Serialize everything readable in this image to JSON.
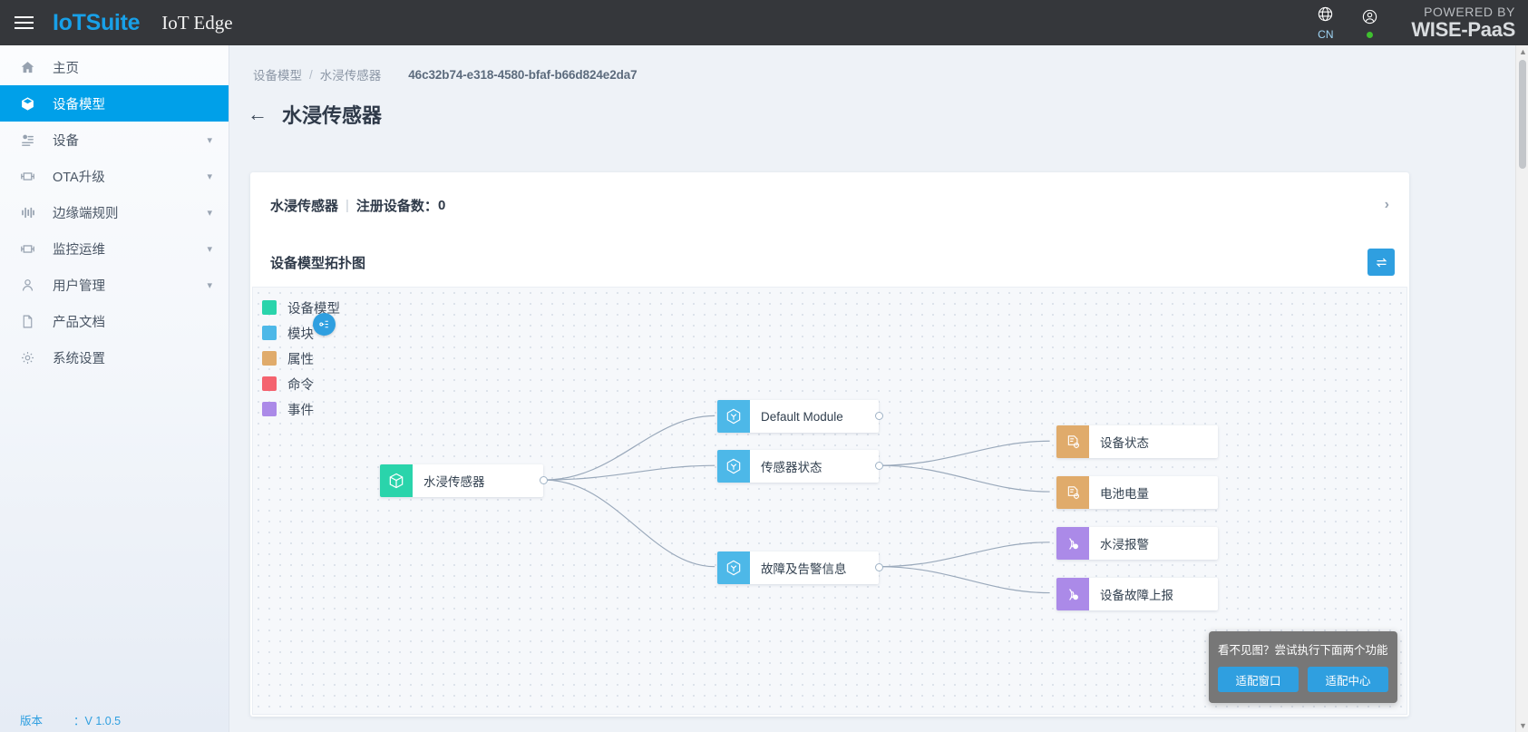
{
  "topbar": {
    "menu_icon": "hamburger-icon",
    "brand": "IoTSuite",
    "subtitle": "IoT Edge",
    "language_icon": "globe-icon",
    "language_label": "CN",
    "account_icon": "user-circle-icon",
    "status_dot_color": "#3fc02f",
    "powered_by_line1": "POWERED BY",
    "powered_by_line2": "WISE-PaaS"
  },
  "sidebar": {
    "items": [
      {
        "label": "主页",
        "icon": "home-icon",
        "expandable": false,
        "active": false
      },
      {
        "label": "设备模型",
        "icon": "cube-icon",
        "expandable": false,
        "active": true
      },
      {
        "label": "设备",
        "icon": "devices-icon",
        "expandable": true,
        "active": false
      },
      {
        "label": "OTA升级",
        "icon": "chip-icon",
        "expandable": true,
        "active": false
      },
      {
        "label": "边缘端规则",
        "icon": "rules-icon",
        "expandable": true,
        "active": false
      },
      {
        "label": "监控运维",
        "icon": "monitor-icon",
        "expandable": true,
        "active": false
      },
      {
        "label": "用户管理",
        "icon": "user-icon",
        "expandable": true,
        "active": false
      },
      {
        "label": "产品文档",
        "icon": "document-icon",
        "expandable": false,
        "active": false
      },
      {
        "label": "系统设置",
        "icon": "gear-icon",
        "expandable": false,
        "active": false
      }
    ],
    "version_label": "版本",
    "version_value": "：V 1.0.5"
  },
  "breadcrumb": {
    "items": [
      "设备模型",
      "水浸传感器"
    ],
    "separator": "/",
    "uuid": "46c32b74-e318-4580-bfaf-b66d824e2da7"
  },
  "page": {
    "back_icon": "arrow-left-icon",
    "title": "水浸传感器"
  },
  "summary_card": {
    "model_name": "水浸传感器",
    "divider": "|",
    "registered_label": "注册设备数：",
    "registered_count": "0",
    "expand_icon": "chevron-right-icon"
  },
  "topology": {
    "title": "设备模型拓扑图",
    "swap_icon": "swap-layout-icon",
    "recenter_icon": "recenter-icon",
    "legend": [
      {
        "label": "设备模型",
        "color": "#2ad4ab"
      },
      {
        "label": "模块",
        "color": "#4db8e8"
      },
      {
        "label": "属性",
        "color": "#e0ab6b"
      },
      {
        "label": "命令",
        "color": "#f4636f"
      },
      {
        "label": "事件",
        "color": "#ab8ae8"
      }
    ],
    "nodes": {
      "root": {
        "label": "水浸传感器",
        "type": "设备模型",
        "color": "#2ad4ab",
        "icon": "cube-node-icon"
      },
      "modules": [
        {
          "label": "Default Module",
          "type": "模块",
          "color": "#4db8e8",
          "icon": "hexagon-node-icon"
        },
        {
          "label": "传感器状态",
          "type": "模块",
          "color": "#4db8e8",
          "icon": "hexagon-node-icon"
        },
        {
          "label": "故障及告警信息",
          "type": "模块",
          "color": "#4db8e8",
          "icon": "hexagon-node-icon"
        }
      ],
      "leaves": [
        {
          "label": "设备状态",
          "type": "属性",
          "color": "#e0ab6b",
          "icon": "property-node-icon",
          "parent": "传感器状态"
        },
        {
          "label": "电池电量",
          "type": "属性",
          "color": "#e0ab6b",
          "icon": "property-node-icon",
          "parent": "传感器状态"
        },
        {
          "label": "水浸报警",
          "type": "事件",
          "color": "#ab8ae8",
          "icon": "event-node-icon",
          "parent": "故障及告警信息"
        },
        {
          "label": "设备故障上报",
          "type": "事件",
          "color": "#ab8ae8",
          "icon": "event-node-icon",
          "parent": "故障及告警信息"
        }
      ]
    },
    "hint": {
      "text": "看不见图？尝试执行下面两个功能",
      "buttons": [
        "适配窗口",
        "适配中心"
      ]
    }
  }
}
